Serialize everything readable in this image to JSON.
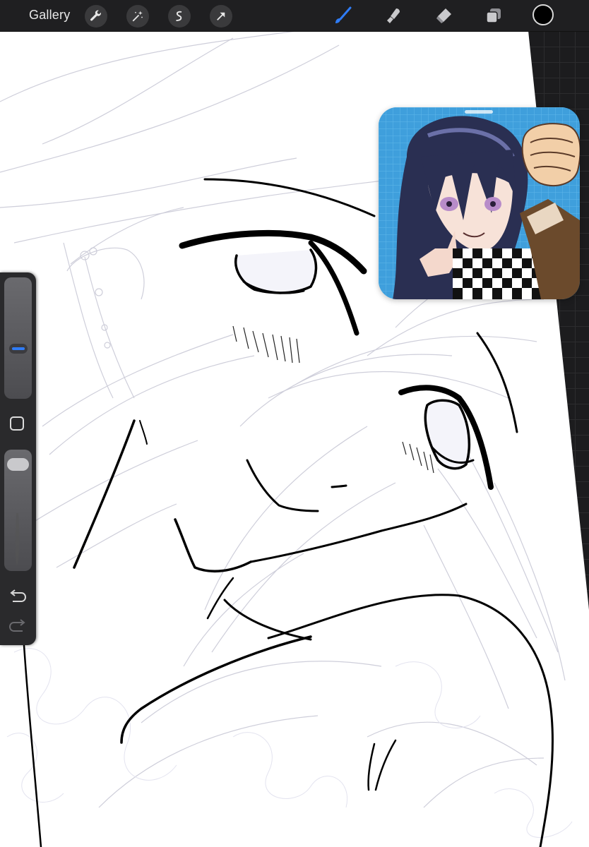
{
  "toolbar": {
    "gallery_label": "Gallery",
    "actions": [
      "wrench-icon",
      "magic-wand-icon",
      "selection-icon",
      "transform-arrow-icon"
    ],
    "tools": [
      "brush-icon",
      "smudge-icon",
      "eraser-icon",
      "layers-icon"
    ],
    "active_tool": "brush",
    "active_color": "#000000",
    "accent": "#2f7cf6"
  },
  "sidebar": {
    "brush_size": 0.4,
    "opacity": 0.95
  },
  "reference": {
    "description_icon": "character-reference-image"
  }
}
